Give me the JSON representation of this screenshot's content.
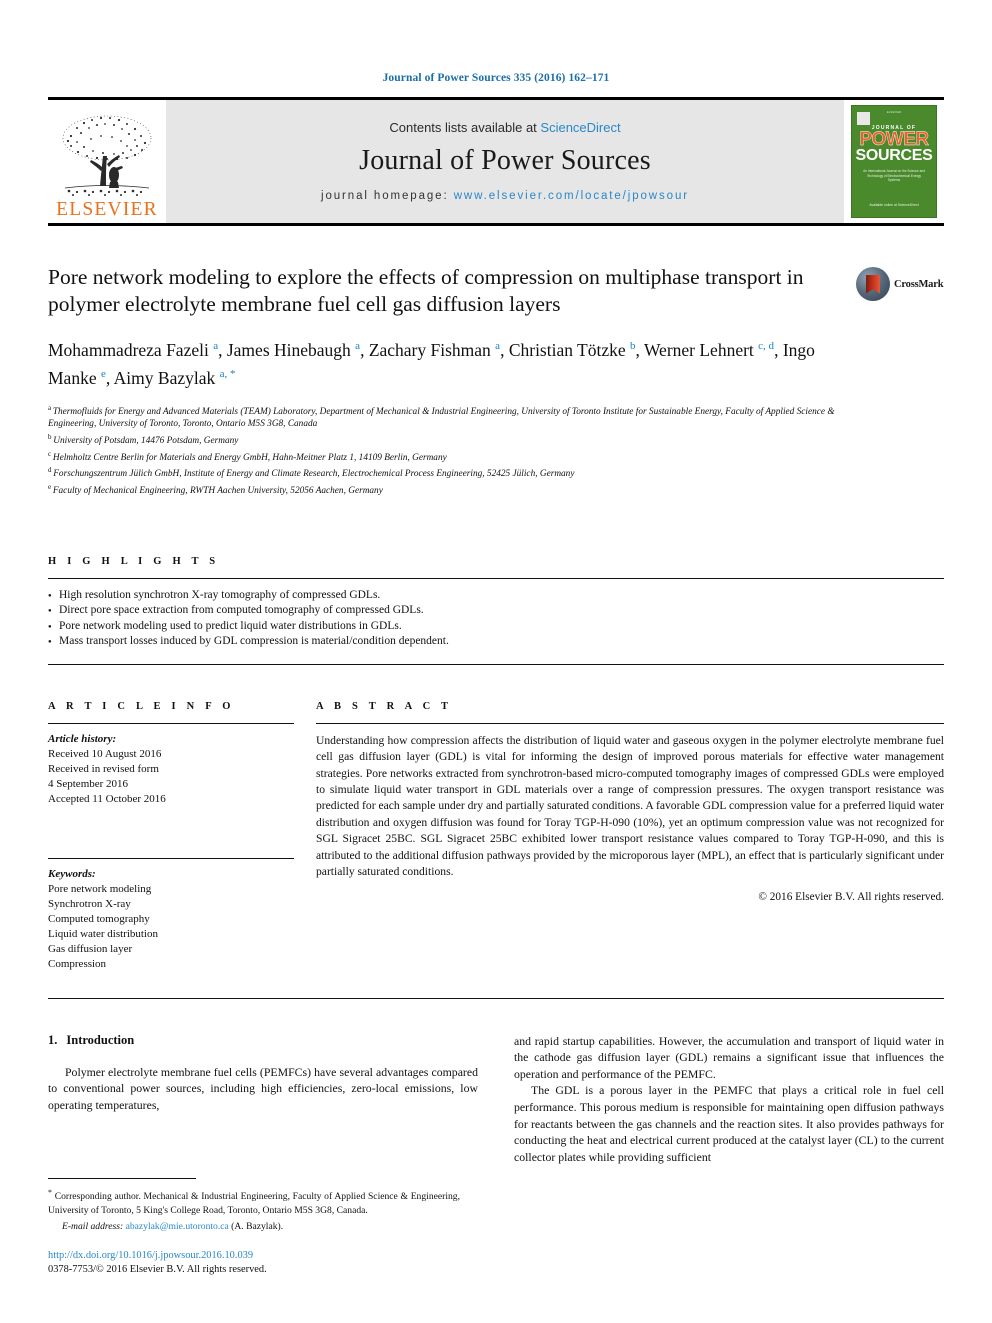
{
  "running_head": "Journal of Power Sources 335 (2016) 162–171",
  "masthead": {
    "publisher_name": "ELSEVIER",
    "contents_prefix": "Contents lists available at ",
    "contents_link": "ScienceDirect",
    "journal_title": "Journal of Power Sources",
    "homepage_prefix": "journal homepage: ",
    "homepage_url": "www.elsevier.com/locate/jpowsour",
    "cover": {
      "tiny_top": "ELSEVIER",
      "journal_of": "JOURNAL OF",
      "power": "POWER",
      "sources": "SOURCES",
      "subtitle": "An International Journal on the Science and Technology of Electrochemical Energy Systems",
      "footer": "Available online at\nScienceDirect"
    }
  },
  "article": {
    "title": "Pore network modeling to explore the effects of compression on multiphase transport in polymer electrolyte membrane fuel cell gas diffusion layers",
    "crossmark_label": "CrossMark",
    "authors": [
      {
        "name": "Mohammadreza Fazeli",
        "marks": "a",
        "sep": ", "
      },
      {
        "name": "James Hinebaugh",
        "marks": "a",
        "sep": ", "
      },
      {
        "name": "Zachary Fishman",
        "marks": "a",
        "sep": ", "
      },
      {
        "name": "Christian Tötzke",
        "marks": "b",
        "sep": ", "
      },
      {
        "name": "Werner Lehnert",
        "marks": "c, d",
        "sep": ", "
      },
      {
        "name": "Ingo Manke",
        "marks": "e",
        "sep": ", "
      },
      {
        "name": "Aimy Bazylak",
        "marks": "a, *",
        "sep": ""
      }
    ],
    "affiliations": [
      {
        "mark": "a",
        "text": "Thermofluids for Energy and Advanced Materials (TEAM) Laboratory, Department of Mechanical & Industrial Engineering, University of Toronto Institute for Sustainable Energy, Faculty of Applied Science & Engineering, University of Toronto, Toronto, Ontario M5S 3G8, Canada"
      },
      {
        "mark": "b",
        "text": "University of Potsdam, 14476 Potsdam, Germany"
      },
      {
        "mark": "c",
        "text": "Helmholtz Centre Berlin for Materials and Energy GmbH, Hahn-Meitner Platz 1, 14109 Berlin, Germany"
      },
      {
        "mark": "d",
        "text": "Forschungszentrum Jülich GmbH, Institute of Energy and Climate Research, Electrochemical Process Engineering, 52425 Jülich, Germany"
      },
      {
        "mark": "e",
        "text": "Faculty of Mechanical Engineering, RWTH Aachen University, 52056 Aachen, Germany"
      }
    ]
  },
  "highlights": {
    "heading": "H I G H L I G H T S",
    "items": [
      "High resolution synchrotron X-ray tomography of compressed GDLs.",
      "Direct pore space extraction from computed tomography of compressed GDLs.",
      "Pore network modeling used to predict liquid water distributions in GDLs.",
      "Mass transport losses induced by GDL compression is material/condition dependent."
    ]
  },
  "article_info": {
    "heading": "A R T I C L E   I N F O",
    "history_label": "Article history:",
    "history_lines": [
      "Received 10 August 2016",
      "Received in revised form",
      "4 September 2016",
      "Accepted 11 October 2016"
    ],
    "keywords_label": "Keywords:",
    "keywords": [
      "Pore network modeling",
      "Synchrotron X-ray",
      "Computed tomography",
      "Liquid water distribution",
      "Gas diffusion layer",
      "Compression"
    ]
  },
  "abstract": {
    "heading": "A B S T R A C T",
    "text": "Understanding how compression affects the distribution of liquid water and gaseous oxygen in the polymer electrolyte membrane fuel cell gas diffusion layer (GDL) is vital for informing the design of improved porous materials for effective water management strategies. Pore networks extracted from synchrotron-based micro-computed tomography images of compressed GDLs were employed to simulate liquid water transport in GDL materials over a range of compression pressures. The oxygen transport resistance was predicted for each sample under dry and partially saturated conditions. A favorable GDL compression value for a preferred liquid water distribution and oxygen diffusion was found for Toray TGP-H-090 (10%), yet an optimum compression value was not recognized for SGL Sigracet 25BC. SGL Sigracet 25BC exhibited lower transport resistance values compared to Toray TGP-H-090, and this is attributed to the additional diffusion pathways provided by the microporous layer (MPL), an effect that is particularly significant under partially saturated conditions.",
    "copyright": "© 2016 Elsevier B.V. All rights reserved."
  },
  "body": {
    "section_number": "1.",
    "section_title": "Introduction",
    "left_paragraphs": [
      "Polymer electrolyte membrane fuel cells (PEMFCs) have several advantages compared to conventional power sources, including high efficiencies, zero-local emissions, low operating temperatures,"
    ],
    "right_paragraphs": [
      "and rapid startup capabilities. However, the accumulation and transport of liquid water in the cathode gas diffusion layer (GDL) remains a significant issue that influences the operation and performance of the PEMFC.",
      "The GDL is a porous layer in the PEMFC that plays a critical role in fuel cell performance. This porous medium is responsible for maintaining open diffusion pathways for reactants between the gas channels and the reaction sites. It also provides pathways for conducting the heat and electrical current produced at the catalyst layer (CL) to the current collector plates while providing sufficient"
    ]
  },
  "footnote": {
    "corresponding": "Corresponding author. Mechanical & Industrial Engineering, Faculty of Applied Science & Engineering, University of Toronto, 5 King's College Road, Toronto, Ontario M5S 3G8, Canada.",
    "email_label": "E-mail address:",
    "email": "abazylak@mie.utoronto.ca",
    "email_suffix": "(A. Bazylak).",
    "doi": "http://dx.doi.org/10.1016/j.jpowsour.2016.10.039",
    "issn": "0378-7753/© 2016 Elsevier B.V. All rights reserved."
  },
  "colors": {
    "link": "#2a87c8",
    "running_head": "#1b6fa8",
    "elsevier_orange": "#E9711C",
    "cover_green": "#4a8a2d",
    "cover_orange": "#E8622A"
  }
}
